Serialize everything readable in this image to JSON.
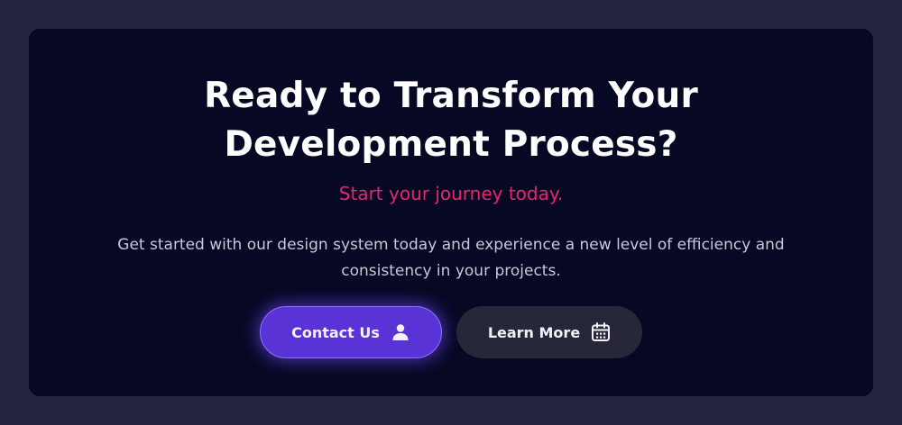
{
  "cta": {
    "title": "Ready to Transform Your Development Process?",
    "subtitle": "Start your journey today.",
    "description": "Get started with our design system today and experience a new level of efficiency and consistency in your projects.",
    "primary_button": {
      "label": "Contact Us",
      "icon": "user-icon"
    },
    "secondary_button": {
      "label": "Learn More",
      "icon": "calendar-icon"
    }
  },
  "colors": {
    "page_background": "#232440",
    "card_background": "#070823",
    "title": "#ffffff",
    "subtitle_accent": "#e8246e",
    "description": "#c7c8d4",
    "primary_button": "#5a33d6",
    "secondary_button": "#262738"
  }
}
